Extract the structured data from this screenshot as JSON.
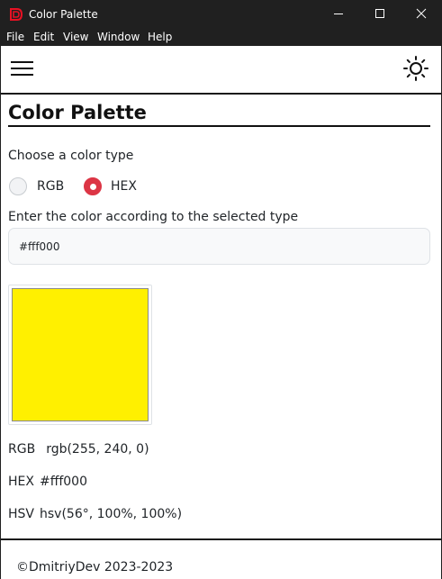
{
  "window": {
    "title": "Color Palette",
    "app_icon": "dmitriydev-logo-icon",
    "accent_color": "#e81123"
  },
  "menu": [
    "File",
    "Edit",
    "Window",
    "View",
    "Help"
  ],
  "appbar": {
    "menu_icon": "hamburger-menu-icon",
    "theme_icon": "sun-icon"
  },
  "page": {
    "title": "Color Palette",
    "choose_label": "Choose a color type",
    "radio_options": [
      {
        "label": "RGB",
        "checked": false
      },
      {
        "label": "HEX",
        "checked": true
      }
    ],
    "input_label": "Enter the color according to the selected type",
    "input_value": "#fff000",
    "swatch_color": "#fff000",
    "values": {
      "rgb_label": "RGB",
      "rgb_value": "rgb(255, 240, 0)",
      "hex_label": "HEX",
      "hex_value": "#fff000",
      "hsv_label": "HSV",
      "hsv_value": "hsv(56°, 100%, 100%)"
    }
  },
  "footer": {
    "text": "©DmitriyDev 2023-2023"
  }
}
